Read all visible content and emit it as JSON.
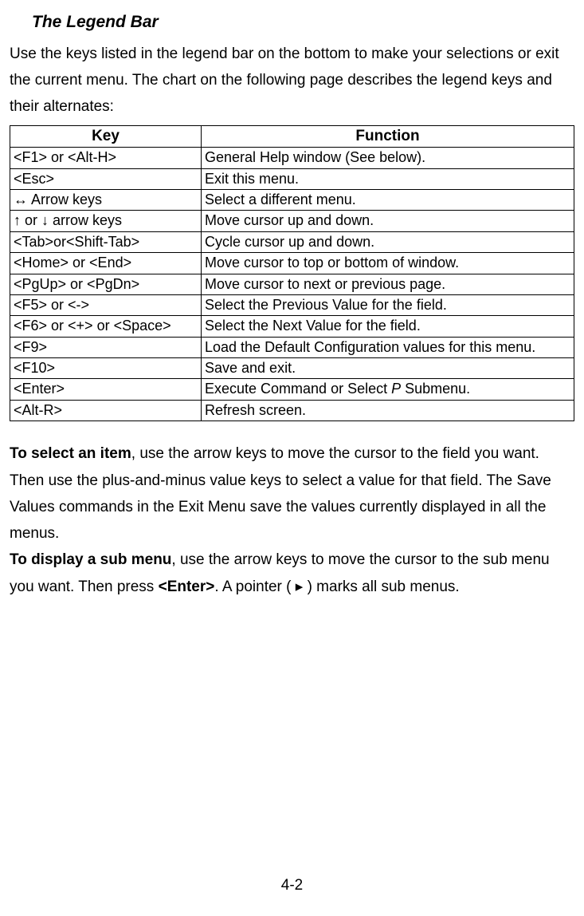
{
  "heading": "The Legend Bar",
  "intro": "Use the keys listed in the legend bar on the bottom to make your selections or exit the current menu. The chart on the following page describes the legend keys and their alternates:",
  "table": {
    "headers": {
      "key": "Key",
      "function": "Function"
    },
    "rows": [
      {
        "key": "<F1> or <Alt-H>",
        "function": "General Help window (See below)."
      },
      {
        "key": "<Esc>",
        "function": "Exit this menu."
      },
      {
        "key": "↔ Arrow keys",
        "function": "Select a different menu."
      },
      {
        "key": "↑ or ↓ arrow keys",
        "function": "Move cursor up and down."
      },
      {
        "key": "<Tab>or<Shift-Tab>",
        "function": "Cycle cursor up and down."
      },
      {
        "key": "<Home> or <End>",
        "function": "Move cursor to top or bottom of window."
      },
      {
        "key": "<PgUp> or <PgDn>",
        "function": "Move cursor to next or previous page."
      },
      {
        "key": "<F5> or <->",
        "function": "Select the Previous Value for the field."
      },
      {
        "key": "<F6> or <+> or <Space>",
        "function": "Select the Next Value for the field."
      },
      {
        "key": "<F9>",
        "function": "Load the Default Configuration values for this menu."
      },
      {
        "key": "<F10>",
        "function": "Save and exit."
      },
      {
        "key": "<Enter>",
        "function_pre": "Execute Command or Select ",
        "function_italic": "P",
        "function_post": " Submenu."
      },
      {
        "key": "<Alt-R>",
        "function": "Refresh screen."
      }
    ]
  },
  "para1": {
    "bold": "To select an item",
    "text": ", use the arrow keys to move the cursor to the field you want. Then use the plus-and-minus value keys to select a value for that field. The Save Values commands in the Exit Menu save the values currently displayed in all the menus."
  },
  "para2": {
    "bold1": "To display a sub menu",
    "text1": ", use the arrow keys to move the cursor to the sub menu you want. Then press ",
    "bold2": "<Enter>",
    "text2": ". A pointer ( ▸ ) marks all sub menus."
  },
  "page_number": "4-2"
}
